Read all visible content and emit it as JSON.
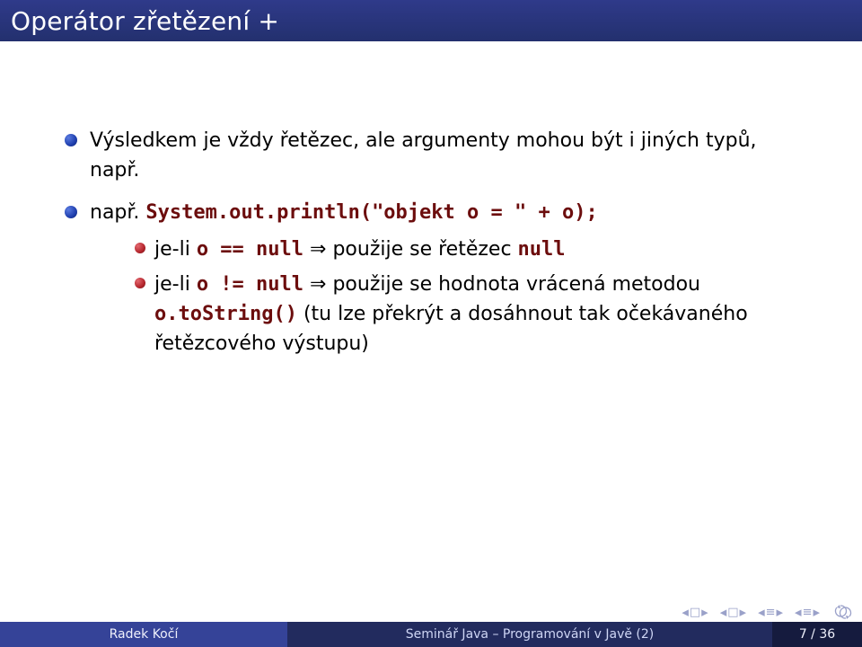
{
  "title": "Operátor zřetězení +",
  "bullets": [
    {
      "text": "Výsledkem je vždy řetězec, ale argumenty mohou být i jiných typů, např."
    },
    {
      "text_prefix": "např. ",
      "code": "System.out.println(\"objekt o = \" + o);",
      "sub": [
        {
          "t1": "je-li ",
          "c1": "o == null",
          "arrow": " ⇒ ",
          "t2": "použije se řetězec ",
          "c2": "null"
        },
        {
          "t1": "je-li ",
          "c1": "o != null",
          "arrow": " ⇒ ",
          "t2": "použije se hodnota vrácená metodou ",
          "c2": "o.toString()",
          "t3": " (tu lze překrýt a dosáhnout tak očekávaného řetězcového výstupu)"
        }
      ]
    }
  ],
  "footer": {
    "author": "Radek Kočí",
    "title": "Seminář Java – Programování v Javě (2)",
    "page": "7 / 36"
  }
}
